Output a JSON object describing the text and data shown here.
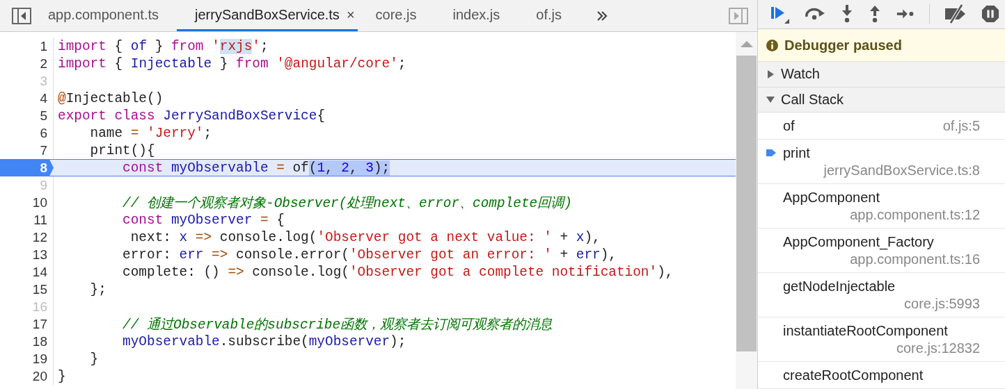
{
  "tabs": [
    {
      "label": "app.component.ts",
      "selected": false
    },
    {
      "label": "jerrySandBoxService.ts",
      "selected": true,
      "close": "×"
    },
    {
      "label": "core.js",
      "selected": false
    },
    {
      "label": "index.js",
      "selected": false
    },
    {
      "label": "of.js",
      "selected": false
    }
  ],
  "code": [
    {
      "number": "1",
      "current": false,
      "tokens": [
        {
          "t": "import",
          "kind": "kw"
        },
        {
          "t": " { ",
          "kind": "plain"
        },
        {
          "t": "of",
          "kind": "def"
        },
        {
          "t": " } ",
          "kind": "plain"
        },
        {
          "t": "from",
          "kind": "kw"
        },
        {
          "t": " '",
          "kind": "str"
        },
        {
          "t": "rxjs",
          "kind": "str",
          "highlight": true
        },
        {
          "t": "'",
          "kind": "str"
        },
        {
          "t": ";",
          "kind": "plain"
        }
      ]
    },
    {
      "number": "2",
      "current": false,
      "tokens": [
        {
          "t": "import",
          "kind": "kw"
        },
        {
          "t": " { ",
          "kind": "plain"
        },
        {
          "t": "Injectable",
          "kind": "def"
        },
        {
          "t": " } ",
          "kind": "plain"
        },
        {
          "t": "from",
          "kind": "kw"
        },
        {
          "t": " '@angular/core'",
          "kind": "str"
        },
        {
          "t": ";",
          "kind": "plain"
        }
      ]
    },
    {
      "number": "3",
      "current": false
    },
    {
      "number": "4",
      "current": false,
      "tokens": [
        {
          "t": "@",
          "kind": "op"
        },
        {
          "t": "Injectable()",
          "kind": "plain"
        }
      ]
    },
    {
      "number": "5",
      "current": false,
      "tokens": [
        {
          "t": "export class",
          "kind": "kw"
        },
        {
          "t": " JerrySandBoxService",
          "kind": "def"
        },
        {
          "t": "{",
          "kind": "plain"
        }
      ]
    },
    {
      "number": "6",
      "current": false,
      "tokens": [
        {
          "t": "    name ",
          "kind": "plain"
        },
        {
          "t": "=",
          "kind": "op"
        },
        {
          "t": " 'Jerry'",
          "kind": "str"
        },
        {
          "t": ";",
          "kind": "plain"
        }
      ]
    },
    {
      "number": "7",
      "current": false,
      "tokens": [
        {
          "t": "    print(){",
          "kind": "plain"
        }
      ]
    },
    {
      "number": "8",
      "current": true,
      "tokens": [
        {
          "t": "        const",
          "kind": "kw"
        },
        {
          "t": " myObservable ",
          "kind": "def"
        },
        {
          "t": "=",
          "kind": "op"
        },
        {
          "t": " of",
          "kind": "plain"
        },
        {
          "t": "(",
          "kind": "plain",
          "highlight": true
        },
        {
          "t": "1",
          "kind": "num",
          "highlight": true
        },
        {
          "t": ", ",
          "kind": "plain",
          "highlight": true
        },
        {
          "t": "2",
          "kind": "num",
          "highlight": true
        },
        {
          "t": ", ",
          "kind": "plain",
          "highlight": true
        },
        {
          "t": "3",
          "kind": "num",
          "highlight": true
        },
        {
          "t": ");",
          "kind": "plain",
          "highlight": true
        }
      ]
    },
    {
      "number": "9",
      "current": false
    },
    {
      "number": "10",
      "current": false,
      "tokens": [
        {
          "t": "        // 创建一个观察者对象-Observer(处理next、error、complete回调)",
          "kind": "com"
        }
      ]
    },
    {
      "number": "11",
      "current": false,
      "tokens": [
        {
          "t": "        const",
          "kind": "kw"
        },
        {
          "t": " myObserver ",
          "kind": "def"
        },
        {
          "t": "=",
          "kind": "op"
        },
        {
          "t": " {",
          "kind": "plain"
        }
      ]
    },
    {
      "number": "12",
      "current": false,
      "tokens": [
        {
          "t": "         next: ",
          "kind": "plain"
        },
        {
          "t": "x",
          "kind": "def"
        },
        {
          "t": " =>",
          "kind": "op"
        },
        {
          "t": " console.log(",
          "kind": "plain"
        },
        {
          "t": "'Observer got a next value: '",
          "kind": "str"
        },
        {
          "t": " + ",
          "kind": "plain"
        },
        {
          "t": "x",
          "kind": "def"
        },
        {
          "t": "),",
          "kind": "plain"
        }
      ]
    },
    {
      "number": "13",
      "current": false,
      "tokens": [
        {
          "t": "        error: ",
          "kind": "plain"
        },
        {
          "t": "err",
          "kind": "def"
        },
        {
          "t": " =>",
          "kind": "op"
        },
        {
          "t": " console.error(",
          "kind": "plain"
        },
        {
          "t": "'Observer got an error: '",
          "kind": "str"
        },
        {
          "t": " + ",
          "kind": "plain"
        },
        {
          "t": "err",
          "kind": "def"
        },
        {
          "t": "),",
          "kind": "plain"
        }
      ]
    },
    {
      "number": "14",
      "current": false,
      "tokens": [
        {
          "t": "        complete: () ",
          "kind": "plain"
        },
        {
          "t": "=>",
          "kind": "op"
        },
        {
          "t": " console.log(",
          "kind": "plain"
        },
        {
          "t": "'Observer got a complete notification'",
          "kind": "str"
        },
        {
          "t": "),",
          "kind": "plain"
        }
      ]
    },
    {
      "number": "15",
      "current": false,
      "tokens": [
        {
          "t": "    };",
          "kind": "plain"
        }
      ]
    },
    {
      "number": "16",
      "current": false
    },
    {
      "number": "17",
      "current": false,
      "tokens": [
        {
          "t": "        // 通过Observable的subscribe函数，观察者去订阅可观察者的消息",
          "kind": "com"
        }
      ]
    },
    {
      "number": "18",
      "current": false,
      "tokens": [
        {
          "t": "        myObservable",
          "kind": "def"
        },
        {
          "t": ".subscribe(",
          "kind": "plain"
        },
        {
          "t": "myObserver",
          "kind": "def"
        },
        {
          "t": ");",
          "kind": "plain"
        }
      ]
    },
    {
      "number": "19",
      "current": false,
      "tokens": [
        {
          "t": "    }",
          "kind": "plain"
        }
      ]
    },
    {
      "number": "20",
      "current": false,
      "tokens": [
        {
          "t": "}",
          "kind": "plain"
        }
      ]
    }
  ],
  "banner": {
    "text": "Debugger paused"
  },
  "sections": [
    {
      "label": "Watch",
      "expanded": false
    },
    {
      "label": "Call Stack",
      "expanded": true
    }
  ],
  "call_stack": [
    {
      "function": "of",
      "location": "of.js:5",
      "current": false
    },
    {
      "function": "print",
      "location": "jerrySandBoxService.ts:8",
      "current": true
    },
    {
      "function": "AppComponent",
      "location": "app.component.ts:12",
      "current": false
    },
    {
      "function": "AppComponent_Factory",
      "location": "app.component.ts:16",
      "current": false
    },
    {
      "function": "getNodeInjectable",
      "location": "core.js:5993",
      "current": false
    },
    {
      "function": "instantiateRootComponent",
      "location": "core.js:12832",
      "current": false
    },
    {
      "function": "createRootComponent",
      "current": false
    }
  ]
}
